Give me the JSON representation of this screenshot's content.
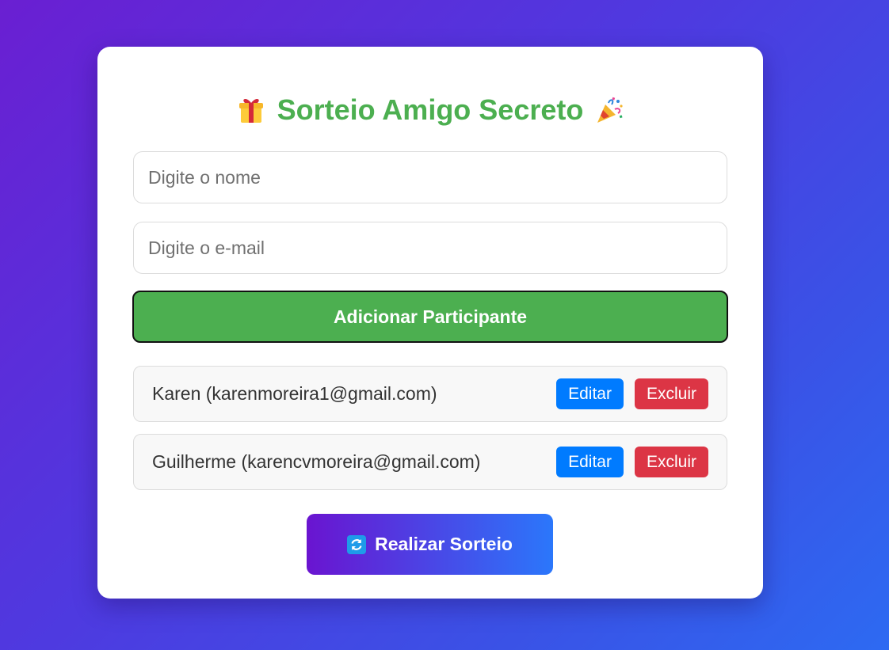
{
  "header": {
    "title": "Sorteio Amigo Secreto",
    "left_icon": "gift-icon",
    "right_icon": "party-popper-icon"
  },
  "form": {
    "name_placeholder": "Digite o nome",
    "name_value": "",
    "email_placeholder": "Digite o e-mail",
    "email_value": "",
    "add_button_label": "Adicionar Participante"
  },
  "participants": [
    {
      "display": "Karen (karenmoreira1@gmail.com)",
      "edit_label": "Editar",
      "delete_label": "Excluir"
    },
    {
      "display": "Guilherme (karencvmoreira@gmail.com)",
      "edit_label": "Editar",
      "delete_label": "Excluir"
    }
  ],
  "draw_button": {
    "label": "Realizar Sorteio",
    "icon": "refresh-icon"
  },
  "colors": {
    "accent_green": "#4caf50",
    "edit_blue": "#007bff",
    "delete_red": "#dc3545",
    "gradient_start": "#6a14d0",
    "gradient_end": "#2b77fb"
  }
}
